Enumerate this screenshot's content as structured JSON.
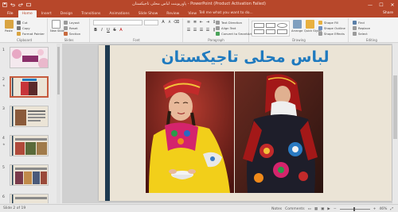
{
  "window": {
    "title": "پاورپوینت لباس محلی تاجیکستان - PowerPoint (Product Activation Failed)"
  },
  "quick_access": {
    "icons": [
      "save-icon",
      "undo-icon",
      "redo-icon",
      "start-slideshow-icon"
    ]
  },
  "window_controls": {
    "minimize": "—",
    "maximize": "☐",
    "close": "✕"
  },
  "ribbon_tabs": [
    {
      "label": "File"
    },
    {
      "label": "Home"
    },
    {
      "label": "Insert"
    },
    {
      "label": "Design"
    },
    {
      "label": "Transitions"
    },
    {
      "label": "Animations"
    },
    {
      "label": "Slide Show"
    },
    {
      "label": "Review"
    },
    {
      "label": "View"
    }
  ],
  "active_tab": "Home",
  "tell_me": "Tell me what you want to do...",
  "share": "Share",
  "ribbon": {
    "clipboard": {
      "group_label": "Clipboard",
      "paste": "Paste",
      "cut": "Cut",
      "copy": "Copy",
      "format_painter": "Format Painter"
    },
    "slides": {
      "group_label": "Slides",
      "new_slide": "New Slide",
      "layout": "Layout",
      "reset": "Reset",
      "section": "Section"
    },
    "font": {
      "group_label": "Font",
      "buttons": [
        "B",
        "I",
        "U",
        "S",
        "A"
      ]
    },
    "paragraph": {
      "group_label": "Paragraph",
      "text_direction": "Text Direction",
      "align_text": "Align Text",
      "convert_smartart": "Convert to SmartArt"
    },
    "drawing": {
      "group_label": "Drawing",
      "arrange": "Arrange",
      "quick_styles": "Quick Styles",
      "shape_fill": "Shape Fill",
      "shape_outline": "Shape Outline",
      "shape_effects": "Shape Effects"
    },
    "editing": {
      "group_label": "Editing",
      "find": "Find",
      "replace": "Replace",
      "select": "Select"
    }
  },
  "thumbnails": {
    "numbers": [
      "1",
      "2",
      "3",
      "4",
      "5",
      "6"
    ],
    "selected": "2"
  },
  "slide": {
    "title": "لباس محلی تاجیکستان"
  },
  "status": {
    "slide_info": "Slide 2 of 19",
    "notes": "Notes",
    "comments": "Comments",
    "zoom": "46%",
    "zoom_fraction": 0.46
  },
  "colors": {
    "accent": "#b7472a",
    "slide_title": "#1f7abf",
    "slide_bar": "#1f3a4f",
    "slide_bg": "#ebe4d6"
  }
}
